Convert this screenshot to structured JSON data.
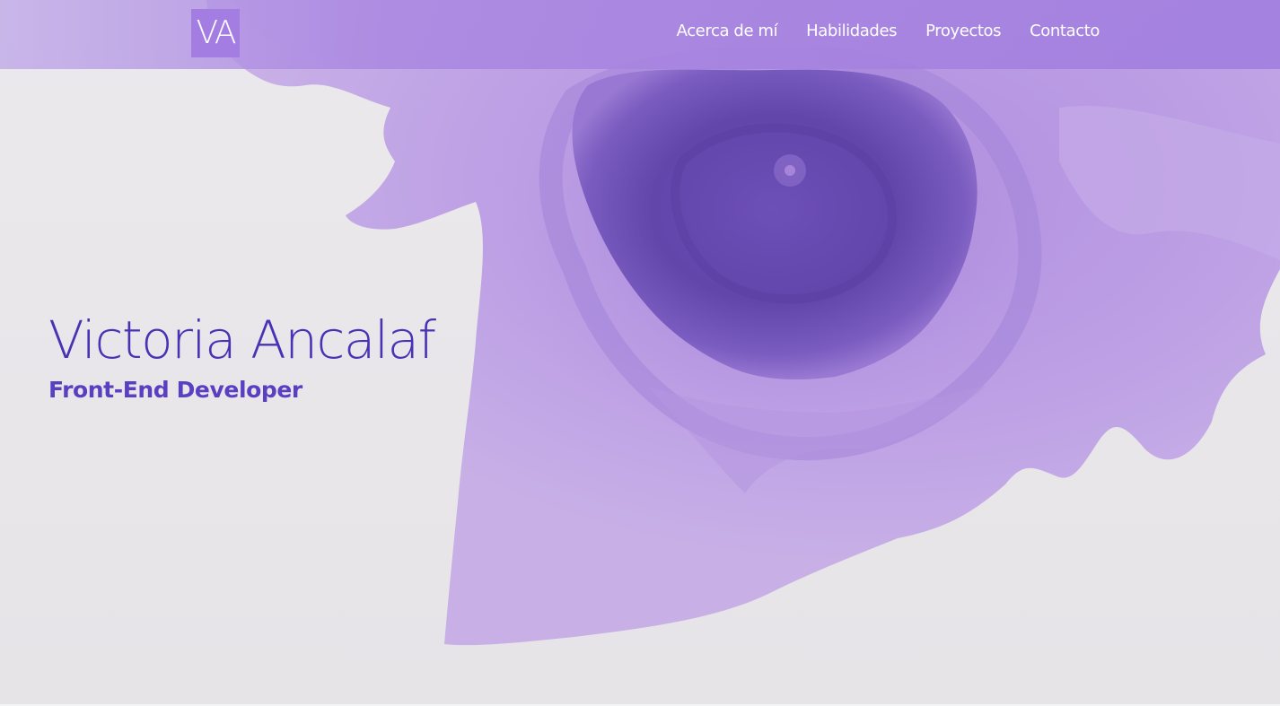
{
  "brand": {
    "logo_text": "VA"
  },
  "nav": {
    "items": [
      {
        "label": "Acerca de mí"
      },
      {
        "label": "Habilidades"
      },
      {
        "label": "Proyectos"
      },
      {
        "label": "Contacto"
      }
    ]
  },
  "hero": {
    "name": "Victoria Ancalaf",
    "role": "Front-End Developer"
  },
  "colors": {
    "accent": "#a47de3",
    "heading": "#4b32b4",
    "navbar": "#aa87e1",
    "ink_light": "#c2a6e6",
    "ink_dark": "#5e3fa6",
    "background": "#e8e6ea"
  }
}
